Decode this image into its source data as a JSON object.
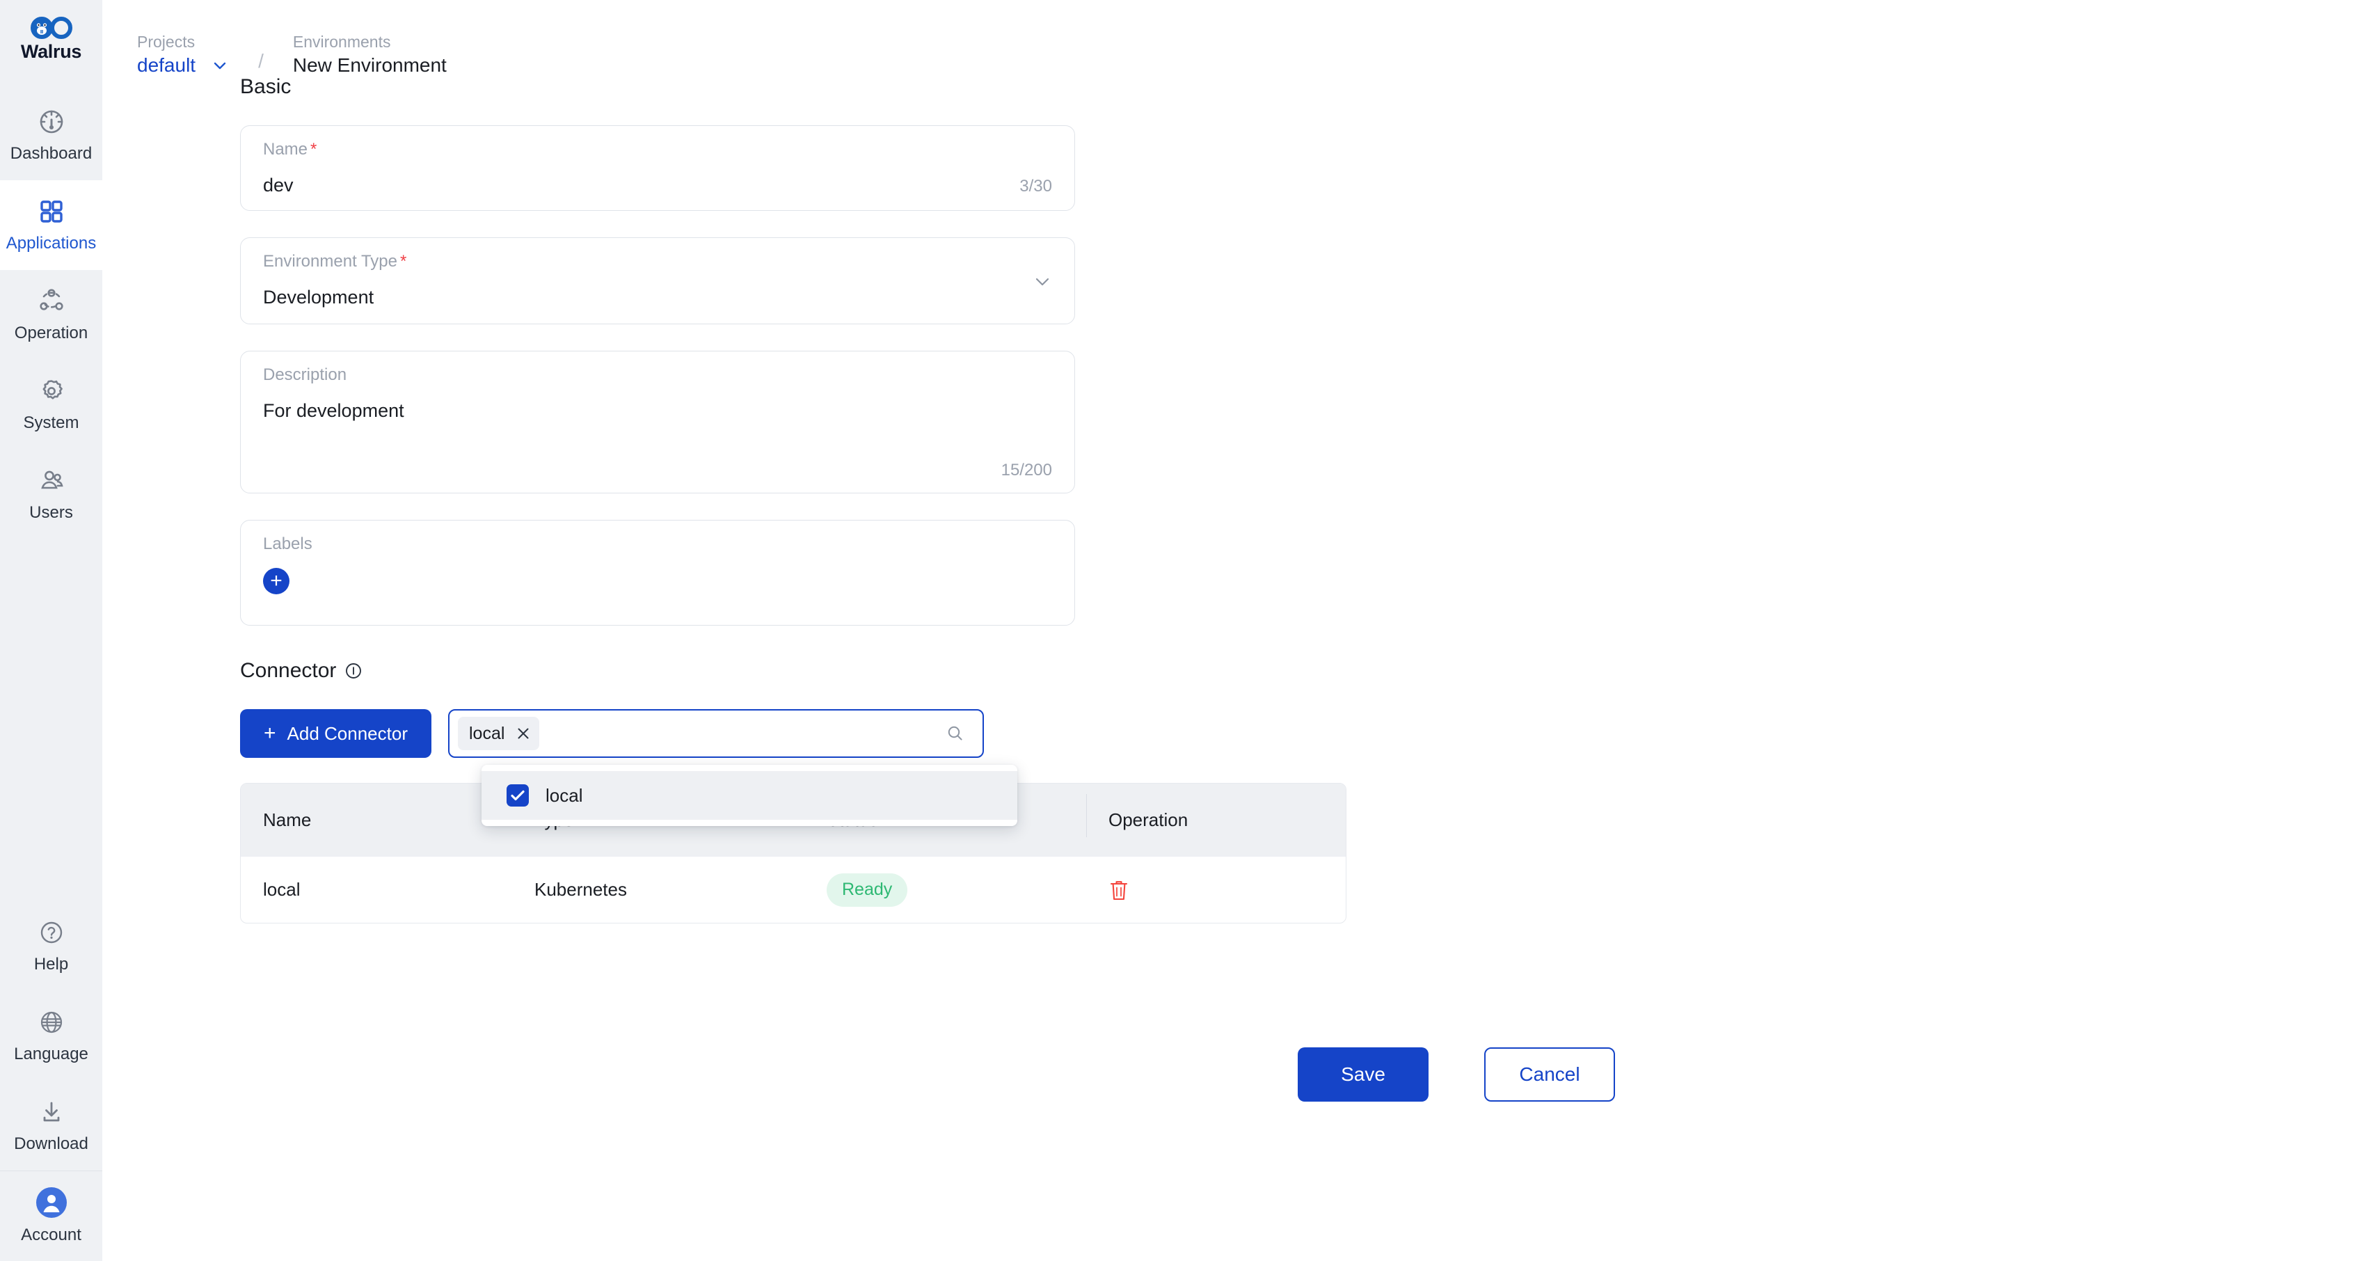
{
  "brand": {
    "name": "Walrus",
    "logo_icon": "walrus-infinity-logo",
    "accent_blue": "#1544c8",
    "sidebar_bg": "#eff1f4"
  },
  "sidebar": {
    "top_items": [
      {
        "label": "Dashboard",
        "icon": "dashboard-gauge-icon",
        "active": false
      },
      {
        "label": "Applications",
        "icon": "applications-grid-icon",
        "active": true
      },
      {
        "label": "Operation",
        "icon": "operation-nodes-icon",
        "active": false
      },
      {
        "label": "System",
        "icon": "gear-icon",
        "active": false
      },
      {
        "label": "Users",
        "icon": "users-icon",
        "active": false
      }
    ],
    "bottom_items": [
      {
        "label": "Help",
        "icon": "help-question-icon"
      },
      {
        "label": "Language",
        "icon": "globe-icon"
      },
      {
        "label": "Download",
        "icon": "download-icon"
      },
      {
        "label": "Account",
        "icon": "account-avatar-icon"
      }
    ]
  },
  "breadcrumb": {
    "project": {
      "kicker": "Projects",
      "value": "default",
      "chevron_icon": "chevron-down-icon"
    },
    "separator": "/",
    "environment": {
      "kicker": "Environments",
      "value": "New Environment"
    }
  },
  "basic": {
    "title": "Basic",
    "name": {
      "label": "Name",
      "required": "*",
      "value": "dev",
      "counter": "3/30"
    },
    "environment_type": {
      "label": "Environment Type",
      "required": "*",
      "value": "Development",
      "chevron_icon": "chevron-down-icon",
      "options": [
        "Development"
      ]
    },
    "description": {
      "label": "Description",
      "value": "For development",
      "counter": "15/200"
    },
    "labels": {
      "label": "Labels",
      "add_icon": "plus-icon"
    }
  },
  "connector": {
    "title": "Connector",
    "info_icon": "info-icon",
    "add_button": {
      "label": "Add Connector",
      "icon": "plus-icon"
    },
    "search": {
      "placeholder": "",
      "value": "",
      "search_icon": "search-icon",
      "tags": [
        {
          "label": "local",
          "remove_icon": "close-icon"
        }
      ]
    },
    "dropdown": {
      "open": true,
      "options": [
        {
          "label": "local",
          "checked": true
        }
      ]
    },
    "table": {
      "columns": [
        "Name",
        "Type",
        "Status",
        "Operation"
      ],
      "rows": [
        {
          "name": "local",
          "type": "Kubernetes",
          "status": "Ready",
          "status_color": "#2eb873",
          "status_bg": "#e2f6ec",
          "operation_icon": "trash-icon"
        }
      ]
    }
  },
  "footer": {
    "save_label": "Save",
    "cancel_label": "Cancel"
  }
}
